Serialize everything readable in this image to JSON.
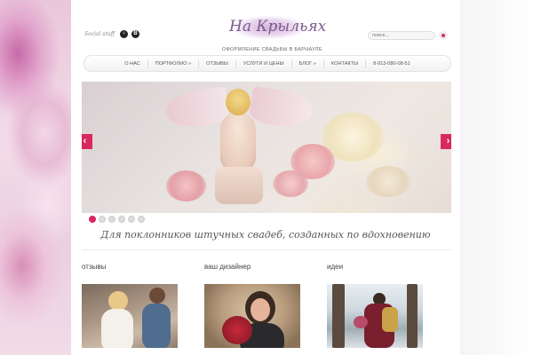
{
  "header": {
    "social_label": "Social stuff",
    "social_buttons": [
      "♀",
      "B"
    ],
    "logo_text": "На Крыльях",
    "tagline": "ОФОРМЛЕНИЕ СВАДЬБЫ В БАРНАУЛЕ",
    "search_placeholder": "поиск..."
  },
  "nav": {
    "items": [
      "О НАС",
      "ПОРТФОЛИО »",
      "ОТЗЫВЫ",
      "УСЛУГИ И ЦЕНЫ",
      "БЛОГ »",
      "КОНТАКТЫ",
      "8-913-080-08-51"
    ]
  },
  "slider": {
    "prev_icon": "‹",
    "next_icon": "›",
    "slide_count": 6,
    "active_index": 0
  },
  "slogan": "Для поклонников штучных свадеб, созданных по вдохновению",
  "sections": [
    {
      "title": "отзывы"
    },
    {
      "title": "ваш дизайнер"
    },
    {
      "title": "идеи"
    }
  ],
  "colors": {
    "accent": "#d8285e",
    "background": "#ffffff"
  }
}
